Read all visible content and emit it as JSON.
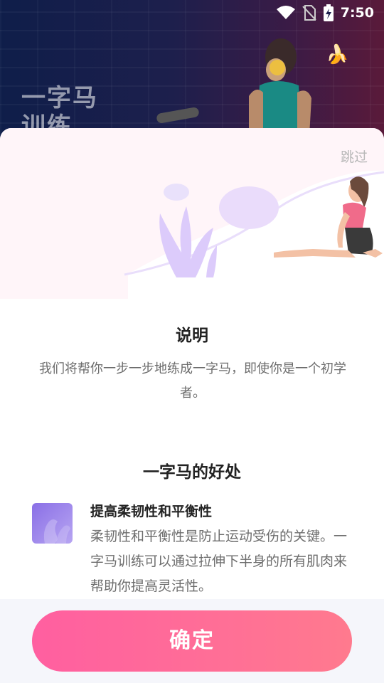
{
  "status_bar": {
    "time": "7:50"
  },
  "hero": {
    "title": "一字马训练"
  },
  "sheet": {
    "skip_label": "跳过",
    "section1": {
      "title": "说明",
      "description": "我们将帮你一步一步地练成一字马，即使你是一个初学者。"
    },
    "section2": {
      "title": "一字马的好处",
      "benefit": {
        "title": "提高柔韧性和平衡性",
        "text": "柔韧性和平衡性是防止运动受伤的关键。一字马训练可以通过拉伸下半身的所有肌肉来帮助你提高灵活性。"
      }
    },
    "confirm_label": "确定"
  }
}
